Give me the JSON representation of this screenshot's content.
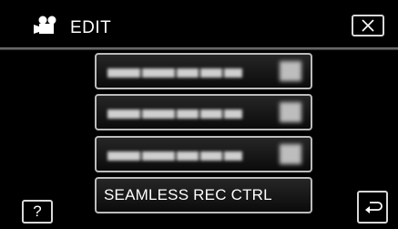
{
  "header": {
    "title": "EDIT",
    "mode_icon": "video-camera-icon",
    "close_icon": "close-icon"
  },
  "menu": {
    "items": [
      {
        "label": "",
        "obscured": true
      },
      {
        "label": "",
        "obscured": true
      },
      {
        "label": "",
        "obscured": true
      },
      {
        "label": "SEAMLESS REC CTRL",
        "obscured": false
      }
    ]
  },
  "footer": {
    "help_label": "?",
    "back_icon": "return-arrow-icon"
  },
  "colors": {
    "background": "#000000",
    "button_border": "#bcbcbc",
    "text": "#ffffff"
  }
}
